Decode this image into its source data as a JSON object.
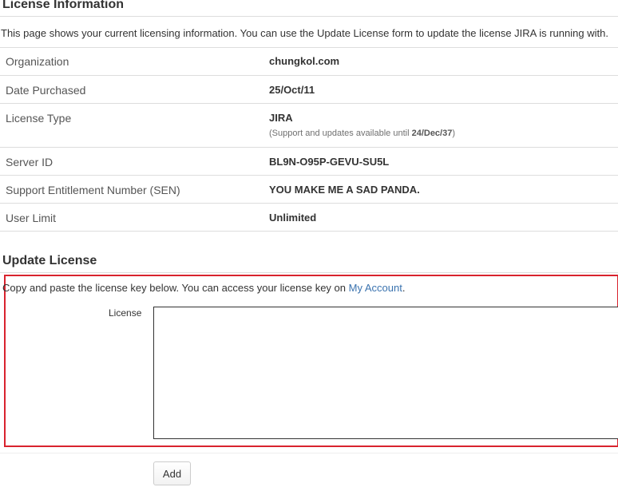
{
  "license_info": {
    "title": "License Information",
    "intro": "This page shows your current licensing information. You can use the Update License form to update the license JIRA is running with.",
    "rows": [
      {
        "label": "Organization",
        "value": "chungkol.com"
      },
      {
        "label": "Date Purchased",
        "value": "25/Oct/11"
      },
      {
        "label": "License Type",
        "value": "JIRA",
        "sub_prefix": "(Support and updates available until ",
        "sub_date": "24/Dec/37",
        "sub_suffix": ")"
      },
      {
        "label": "Server ID",
        "value": "BL9N-O95P-GEVU-SU5L"
      },
      {
        "label": "Support Entitlement Number (SEN)",
        "value": "YOU MAKE ME A SAD PANDA."
      },
      {
        "label": "User Limit",
        "value": "Unlimited"
      }
    ]
  },
  "update_license": {
    "title": "Update License",
    "intro": "Copy and paste the license key below. You can access your license key on ",
    "link_text": "My Account",
    "intro_end": ".",
    "field_label": "License",
    "textarea_value": "",
    "add_label": "Add"
  },
  "colors": {
    "highlight": "#d9232e",
    "link": "#3b73af"
  }
}
